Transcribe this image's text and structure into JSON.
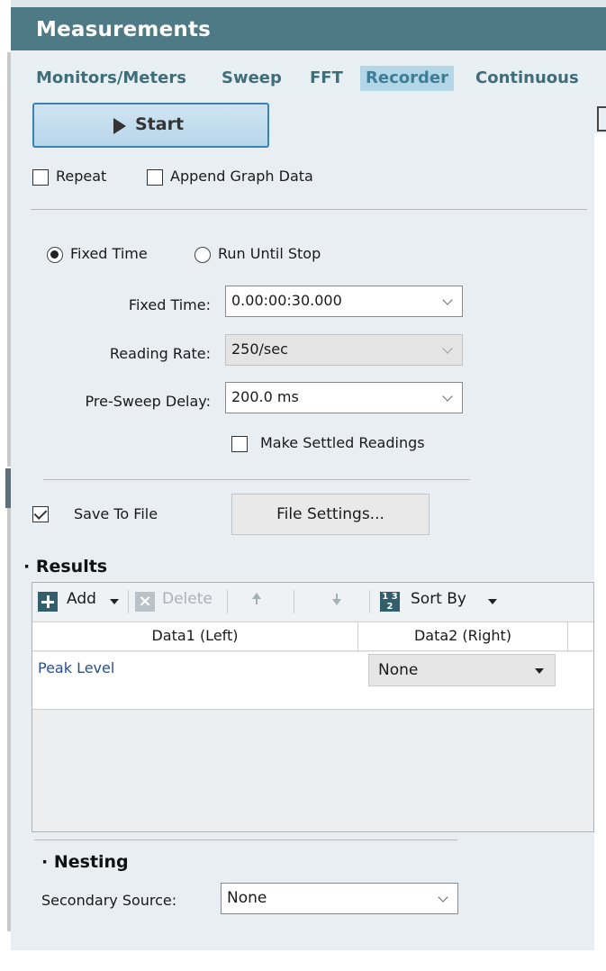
{
  "panel": {
    "title": "Measurements",
    "tabs": [
      {
        "label": "Monitors/Meters",
        "active": false
      },
      {
        "label": "Sweep",
        "active": false
      },
      {
        "label": "FFT",
        "active": false
      },
      {
        "label": "Recorder",
        "active": true
      },
      {
        "label": "Continuous",
        "active": false
      }
    ]
  },
  "run": {
    "start_label": "Start",
    "repeat_label": "Repeat",
    "repeat_checked": false,
    "append_label": "Append Graph Data",
    "append_checked": false
  },
  "timing": {
    "fixed_time_option": "Fixed Time",
    "run_until_stop_option": "Run Until Stop",
    "selected": "Fixed Time",
    "fixed_time_label": "Fixed Time:",
    "fixed_time_value": "0.00:00:30.000",
    "reading_rate_label": "Reading Rate:",
    "reading_rate_value": "250/sec",
    "pre_sweep_label": "Pre-Sweep Delay:",
    "pre_sweep_value": "200.0 ms",
    "settled_label": "Make Settled Readings",
    "settled_checked": false
  },
  "file": {
    "save_label": "Save To File",
    "save_checked": true,
    "settings_button": "File Settings..."
  },
  "results": {
    "heading": "Results",
    "toolbar": {
      "add_label": "Add",
      "delete_label": "Delete",
      "sort_label": "Sort By"
    },
    "columns": [
      "Data1 (Left)",
      "Data2 (Right)"
    ],
    "rows": [
      {
        "data1": "Peak Level",
        "data2": "None"
      }
    ]
  },
  "nesting": {
    "heading": "Nesting",
    "secondary_label": "Secondary Source:",
    "secondary_value": "None"
  },
  "colors": {
    "title_bar": "#4d7a85",
    "panel_bg": "#e8eef2",
    "tab_text": "#3f6e7a",
    "active_tab_bg": "#b4d7e7",
    "start_border": "#3a82b5",
    "link_text": "#2a4f8f"
  }
}
